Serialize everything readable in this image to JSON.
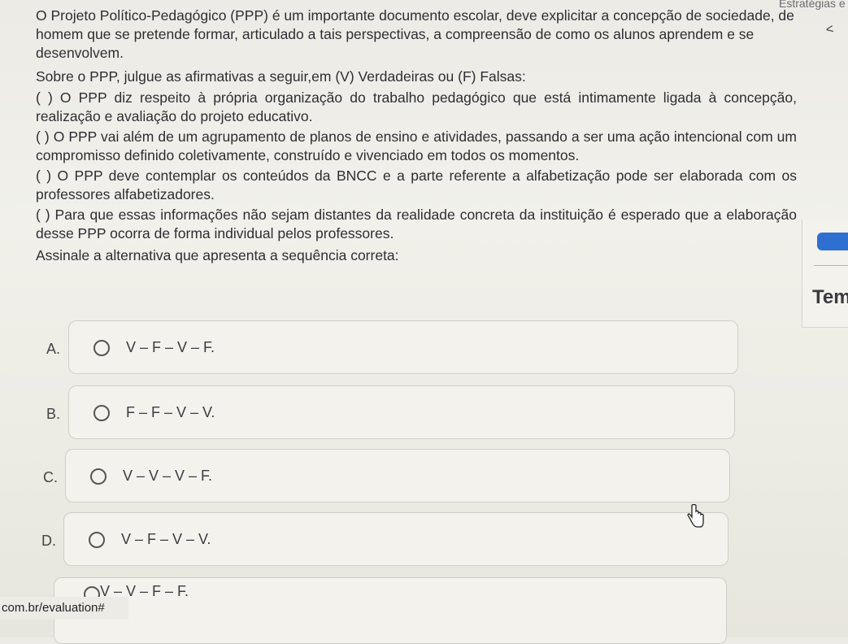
{
  "corner": {
    "strategy_text": "Estratégias e"
  },
  "question": {
    "intro": "O Projeto Político-Pedagógico (PPP) é um importante documento escolar, deve explicitar a concepção de sociedade, de homem que se pretende formar, articulado a tais perspectivas, a compreensão de como os alunos aprendem e se desenvolvem.",
    "prompt": "Sobre o PPP, julgue as afirmativas a seguir,em (V) Verdadeiras ou (F) Falsas:",
    "items": [
      "( ) O PPP diz respeito à própria organização do trabalho pedagógico que está intimamente ligada à concepção, realização e avaliação do projeto educativo.",
      "( ) O PPP vai além de um agrupamento de planos de ensino e atividades, passando a ser uma ação intencional com um compromisso definido coletivamente, construído e vivenciado em todos os momentos.",
      "( ) O PPP deve contemplar os conteúdos da BNCC e a parte referente a alfabetização pode ser elaborada com os professores alfabetizadores.",
      "( ) Para que essas informações não sejam distantes da realidade concreta da instituição é esperado que a elaboração desse PPP ocorra de forma individual pelos professores."
    ],
    "instruction": "Assinale a alternativa que apresenta a sequência correta:"
  },
  "options": [
    {
      "letter": "A.",
      "text": "V – F – V – F."
    },
    {
      "letter": "B.",
      "text": "F – F – V – V."
    },
    {
      "letter": "C.",
      "text": "V – V – V – F."
    },
    {
      "letter": "D.",
      "text": "V – F – V – V."
    },
    {
      "letter": "",
      "text": "V – V – F – F."
    }
  ],
  "right_panel": {
    "label": "Tem",
    "bar_color": "#2f6fd0"
  },
  "url": {
    "text": "com.br/evaluation#"
  }
}
